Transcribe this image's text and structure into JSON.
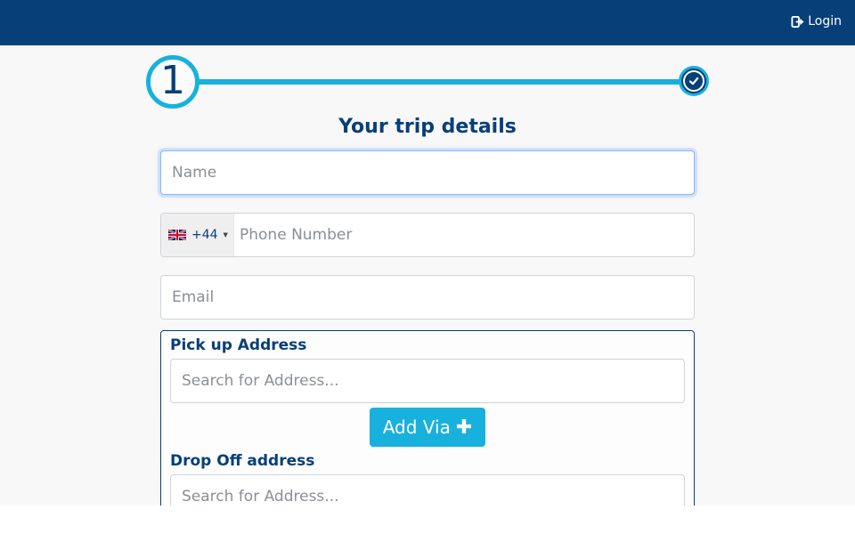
{
  "header": {
    "login_label": "Login"
  },
  "progress": {
    "current_step": "1"
  },
  "form": {
    "title": "Your trip details",
    "name_placeholder": "Name",
    "phone": {
      "country_code": "+44",
      "placeholder": "Phone Number"
    },
    "email_placeholder": "Email"
  },
  "address": {
    "pickup_label": "Pick up Address",
    "pickup_placeholder": "Search for Address...",
    "add_via_label": "Add Via",
    "dropoff_label": "Drop Off address",
    "dropoff_placeholder": "Search for Address..."
  },
  "colors": {
    "brand": "#073f78",
    "accent": "#18b1dd",
    "background": "#f8f8f9"
  },
  "icons": {
    "login": "sign-in-icon",
    "step_complete": "check-circle-icon",
    "flag": "uk-flag-icon",
    "plus": "plus-icon"
  }
}
